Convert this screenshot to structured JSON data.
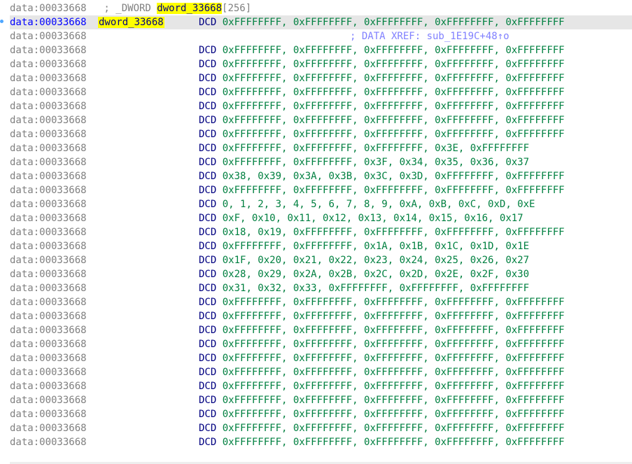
{
  "header": {
    "address": "data:00033668",
    "prefix": " ; _DWORD ",
    "name": "dword_33668",
    "suffix": "[256]"
  },
  "current": {
    "address": "data:00033668",
    "label": "dword_33668",
    "op": "DCD",
    "operands": "0xFFFFFFFF, 0xFFFFFFFF, 0xFFFFFFFF, 0xFFFFFFFF, 0xFFFFFFFF"
  },
  "xref": {
    "address": "data:00033668",
    "text": "; DATA XREF: sub_1E19C+48↑o"
  },
  "rows": [
    {
      "address": "data:00033668",
      "op": "DCD",
      "operands": "0xFFFFFFFF, 0xFFFFFFFF, 0xFFFFFFFF, 0xFFFFFFFF, 0xFFFFFFFF"
    },
    {
      "address": "data:00033668",
      "op": "DCD",
      "operands": "0xFFFFFFFF, 0xFFFFFFFF, 0xFFFFFFFF, 0xFFFFFFFF, 0xFFFFFFFF"
    },
    {
      "address": "data:00033668",
      "op": "DCD",
      "operands": "0xFFFFFFFF, 0xFFFFFFFF, 0xFFFFFFFF, 0xFFFFFFFF, 0xFFFFFFFF"
    },
    {
      "address": "data:00033668",
      "op": "DCD",
      "operands": "0xFFFFFFFF, 0xFFFFFFFF, 0xFFFFFFFF, 0xFFFFFFFF, 0xFFFFFFFF"
    },
    {
      "address": "data:00033668",
      "op": "DCD",
      "operands": "0xFFFFFFFF, 0xFFFFFFFF, 0xFFFFFFFF, 0xFFFFFFFF, 0xFFFFFFFF"
    },
    {
      "address": "data:00033668",
      "op": "DCD",
      "operands": "0xFFFFFFFF, 0xFFFFFFFF, 0xFFFFFFFF, 0xFFFFFFFF, 0xFFFFFFFF"
    },
    {
      "address": "data:00033668",
      "op": "DCD",
      "operands": "0xFFFFFFFF, 0xFFFFFFFF, 0xFFFFFFFF, 0xFFFFFFFF, 0xFFFFFFFF"
    },
    {
      "address": "data:00033668",
      "op": "DCD",
      "operands": "0xFFFFFFFF, 0xFFFFFFFF, 0xFFFFFFFF, 0x3E, 0xFFFFFFFF"
    },
    {
      "address": "data:00033668",
      "op": "DCD",
      "operands": "0xFFFFFFFF, 0xFFFFFFFF, 0x3F, 0x34, 0x35, 0x36, 0x37"
    },
    {
      "address": "data:00033668",
      "op": "DCD",
      "operands": "0x38, 0x39, 0x3A, 0x3B, 0x3C, 0x3D, 0xFFFFFFFF, 0xFFFFFFFF"
    },
    {
      "address": "data:00033668",
      "op": "DCD",
      "operands": "0xFFFFFFFF, 0xFFFFFFFF, 0xFFFFFFFF, 0xFFFFFFFF, 0xFFFFFFFF"
    },
    {
      "address": "data:00033668",
      "op": "DCD",
      "operands": "0, 1, 2, 3, 4, 5, 6, 7, 8, 9, 0xA, 0xB, 0xC, 0xD, 0xE"
    },
    {
      "address": "data:00033668",
      "op": "DCD",
      "operands": "0xF, 0x10, 0x11, 0x12, 0x13, 0x14, 0x15, 0x16, 0x17"
    },
    {
      "address": "data:00033668",
      "op": "DCD",
      "operands": "0x18, 0x19, 0xFFFFFFFF, 0xFFFFFFFF, 0xFFFFFFFF, 0xFFFFFFFF"
    },
    {
      "address": "data:00033668",
      "op": "DCD",
      "operands": "0xFFFFFFFF, 0xFFFFFFFF, 0x1A, 0x1B, 0x1C, 0x1D, 0x1E"
    },
    {
      "address": "data:00033668",
      "op": "DCD",
      "operands": "0x1F, 0x20, 0x21, 0x22, 0x23, 0x24, 0x25, 0x26, 0x27"
    },
    {
      "address": "data:00033668",
      "op": "DCD",
      "operands": "0x28, 0x29, 0x2A, 0x2B, 0x2C, 0x2D, 0x2E, 0x2F, 0x30"
    },
    {
      "address": "data:00033668",
      "op": "DCD",
      "operands": "0x31, 0x32, 0x33, 0xFFFFFFFF, 0xFFFFFFFF, 0xFFFFFFFF"
    },
    {
      "address": "data:00033668",
      "op": "DCD",
      "operands": "0xFFFFFFFF, 0xFFFFFFFF, 0xFFFFFFFF, 0xFFFFFFFF, 0xFFFFFFFF"
    },
    {
      "address": "data:00033668",
      "op": "DCD",
      "operands": "0xFFFFFFFF, 0xFFFFFFFF, 0xFFFFFFFF, 0xFFFFFFFF, 0xFFFFFFFF"
    },
    {
      "address": "data:00033668",
      "op": "DCD",
      "operands": "0xFFFFFFFF, 0xFFFFFFFF, 0xFFFFFFFF, 0xFFFFFFFF, 0xFFFFFFFF"
    },
    {
      "address": "data:00033668",
      "op": "DCD",
      "operands": "0xFFFFFFFF, 0xFFFFFFFF, 0xFFFFFFFF, 0xFFFFFFFF, 0xFFFFFFFF"
    },
    {
      "address": "data:00033668",
      "op": "DCD",
      "operands": "0xFFFFFFFF, 0xFFFFFFFF, 0xFFFFFFFF, 0xFFFFFFFF, 0xFFFFFFFF"
    },
    {
      "address": "data:00033668",
      "op": "DCD",
      "operands": "0xFFFFFFFF, 0xFFFFFFFF, 0xFFFFFFFF, 0xFFFFFFFF, 0xFFFFFFFF"
    },
    {
      "address": "data:00033668",
      "op": "DCD",
      "operands": "0xFFFFFFFF, 0xFFFFFFFF, 0xFFFFFFFF, 0xFFFFFFFF, 0xFFFFFFFF"
    },
    {
      "address": "data:00033668",
      "op": "DCD",
      "operands": "0xFFFFFFFF, 0xFFFFFFFF, 0xFFFFFFFF, 0xFFFFFFFF, 0xFFFFFFFF"
    },
    {
      "address": "data:00033668",
      "op": "DCD",
      "operands": "0xFFFFFFFF, 0xFFFFFFFF, 0xFFFFFFFF, 0xFFFFFFFF, 0xFFFFFFFF"
    },
    {
      "address": "data:00033668",
      "op": "DCD",
      "operands": "0xFFFFFFFF, 0xFFFFFFFF, 0xFFFFFFFF, 0xFFFFFFFF, 0xFFFFFFFF"
    },
    {
      "address": "data:00033668",
      "op": "DCD",
      "operands": "0xFFFFFFFF, 0xFFFFFFFF, 0xFFFFFFFF, 0xFFFFFFFF, 0xFFFFFFFF"
    }
  ],
  "colors": {
    "address": "#808080",
    "current_address": "#0000ff",
    "mnemonic": "#000080",
    "operands": "#008040",
    "xref": "#8080ff",
    "label_highlight": "#ffff00",
    "current_line_bg": "#e6e6e6"
  }
}
